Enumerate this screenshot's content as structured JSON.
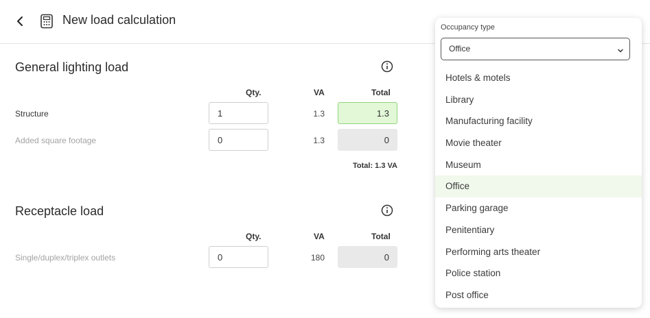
{
  "header": {
    "title": "New load calculation"
  },
  "general_lighting": {
    "title": "General lighting load",
    "columns": {
      "qty": "Qty.",
      "va": "VA",
      "total": "Total"
    },
    "rows": [
      {
        "label": "Structure",
        "qty": "1",
        "va": "1.3",
        "total": "1.3"
      },
      {
        "label": "Added square footage",
        "qty": "0",
        "va": "1.3",
        "total": "0"
      }
    ],
    "summary": "Total: 1.3 VA"
  },
  "receptacle": {
    "title": "Receptacle load",
    "columns": {
      "qty": "Qty.",
      "va": "VA",
      "total": "Total"
    },
    "rows": [
      {
        "label": "Single/duplex/triplex outlets",
        "qty": "0",
        "va": "180",
        "total": "0"
      }
    ]
  },
  "occupancy": {
    "label": "Occupancy type",
    "selected": "Office",
    "options": [
      "Hotels & motels",
      "Library",
      "Manufacturing facility",
      "Movie theater",
      "Museum",
      "Office",
      "Parking garage",
      "Penitentiary",
      "Performing arts theater",
      "Police station",
      "Post office"
    ]
  },
  "colors": {
    "highlight_green": "#e2f8d7",
    "highlight_border": "#8fd57a",
    "selected_row": "#f1f8ec"
  }
}
